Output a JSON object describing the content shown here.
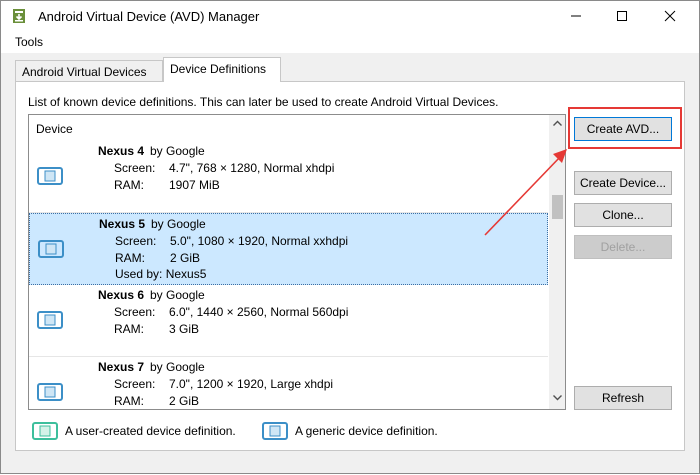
{
  "window": {
    "title": "Android Virtual Device (AVD) Manager"
  },
  "menubar": {
    "tools": "Tools"
  },
  "tabs": [
    {
      "label": "Android Virtual Devices",
      "active": false
    },
    {
      "label": "Device Definitions",
      "active": true
    }
  ],
  "description": "List of known device definitions. This can later be used to create Android Virtual Devices.",
  "list": {
    "header": "Device",
    "devices": [
      {
        "name": "Nexus 4",
        "by": "by Google",
        "screen_label": "Screen:",
        "screen": "4.7\", 768 × 1280, Normal xhdpi",
        "ram_label": "RAM:",
        "ram": "1907 MiB",
        "used_by": ""
      },
      {
        "name": "Nexus 5",
        "by": "by Google",
        "screen_label": "Screen:",
        "screen": "5.0\", 1080 × 1920, Normal xxhdpi",
        "ram_label": "RAM:",
        "ram": "2 GiB",
        "used_by": "Used by: Nexus5"
      },
      {
        "name": "Nexus 6",
        "by": "by Google",
        "screen_label": "Screen:",
        "screen": "6.0\", 1440 × 2560, Normal 560dpi",
        "ram_label": "RAM:",
        "ram": "3 GiB",
        "used_by": ""
      },
      {
        "name": "Nexus 7",
        "by": "by Google",
        "screen_label": "Screen:",
        "screen": "7.0\", 1200 × 1920, Large xhdpi",
        "ram_label": "RAM:",
        "ram": "2 GiB",
        "used_by": ""
      }
    ]
  },
  "buttons": {
    "create_avd": "Create AVD...",
    "create_device": "Create Device...",
    "clone": "Clone...",
    "delete": "Delete...",
    "refresh": "Refresh"
  },
  "legend": {
    "user_created": "A user-created device definition.",
    "generic": "A generic device definition."
  },
  "colors": {
    "selection": "#cce8ff",
    "annotation": "#e53935",
    "user_icon": "#3dbf9c",
    "generic_icon": "#3c8fc7"
  }
}
